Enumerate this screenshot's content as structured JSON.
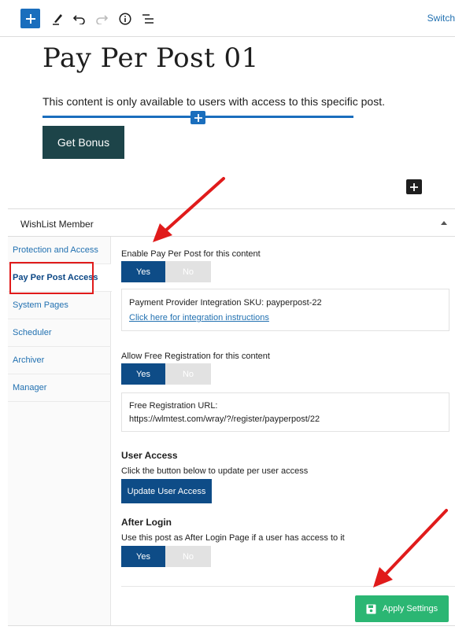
{
  "toolbar": {
    "add_icon": "plus-icon",
    "tools_icon": "pencil-icon",
    "undo_icon": "undo-icon",
    "redo_icon": "redo-icon",
    "info_icon": "info-icon",
    "outline_icon": "list-view-icon",
    "switch_label": "Switch"
  },
  "post": {
    "title": "Pay Per Post 01",
    "paragraph": "This content is only available to users with access to this specific post.",
    "button_label": "Get Bonus"
  },
  "metabox": {
    "title": "WishList Member",
    "tabs": [
      {
        "label": "Protection and Access"
      },
      {
        "label": "Pay Per Post Access"
      },
      {
        "label": "System Pages"
      },
      {
        "label": "Scheduler"
      },
      {
        "label": "Archiver"
      },
      {
        "label": "Manager"
      }
    ],
    "active_tab": "Pay Per Post Access",
    "ppp": {
      "enable_label": "Enable Pay Per Post for this content",
      "yes": "Yes",
      "no": "No",
      "sku_text": "Payment Provider Integration SKU: payperpost-22",
      "sku_link": "Click here for integration instructions",
      "free_reg_label": "Allow Free Registration for this content",
      "free_reg_url_label": "Free Registration URL:",
      "free_reg_url": "https://wlmtest.com/wray/?/register/payperpost/22",
      "user_access_heading": "User Access",
      "user_access_desc": "Click the button below to update per user access",
      "update_button": "Update User Access",
      "after_login_heading": "After Login",
      "after_login_desc": "Use this post as After Login Page if a user has access to it",
      "apply_button": "Apply Settings"
    }
  },
  "colors": {
    "accent_blue": "#1a6ebd",
    "toggle_on": "#0e4c87",
    "apply_green": "#2bb673",
    "annotation_red": "#e01b1b"
  }
}
